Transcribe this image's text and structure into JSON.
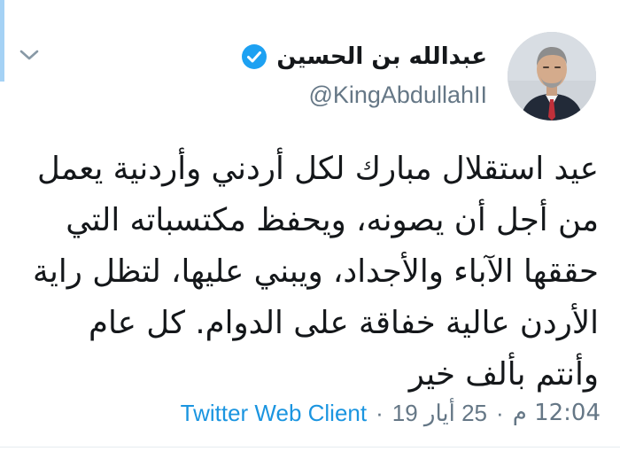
{
  "tweet": {
    "author": {
      "display_name": "عبدالله بن الحسين",
      "handle": "@KingAbdullahII",
      "verified": true
    },
    "text": "عيد استقلال مبارك لكل أردني وأردنية يعمل من أجل أن يصونه، ويحفظ مكتسباته التي حققها الآباء والأجداد، ويبني عليها، لتظل راية الأردن عالية خفاقة على الدوام. كل عام وأنتم بألف خير",
    "time": "12:04 م",
    "date": "25 أيار 19",
    "separator": "·",
    "source": "Twitter Web Client"
  },
  "icons": {
    "menu": "chevron-down-icon",
    "verified": "verified-badge-icon"
  },
  "colors": {
    "text": "#14171a",
    "secondary": "#657786",
    "link": "#1b95e0",
    "verified": "#1da1f2",
    "accent_strip": "#a5d2f5"
  }
}
